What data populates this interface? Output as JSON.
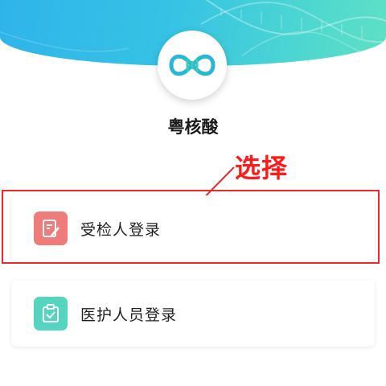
{
  "app": {
    "title": "粤核酸",
    "colors": {
      "header_start": "#2fb4ea",
      "header_end": "#5fe0c6",
      "accent_red": "#e8292d"
    }
  },
  "annotation": {
    "text": "选择",
    "color": "#ff1a1a"
  },
  "login_options": [
    {
      "label": "受检人登录",
      "icon": "edit-document-icon",
      "color": "#ef7b7b",
      "highlighted": true
    },
    {
      "label": "医护人员登录",
      "icon": "clipboard-check-icon",
      "color": "#55d5c0",
      "highlighted": false
    }
  ]
}
